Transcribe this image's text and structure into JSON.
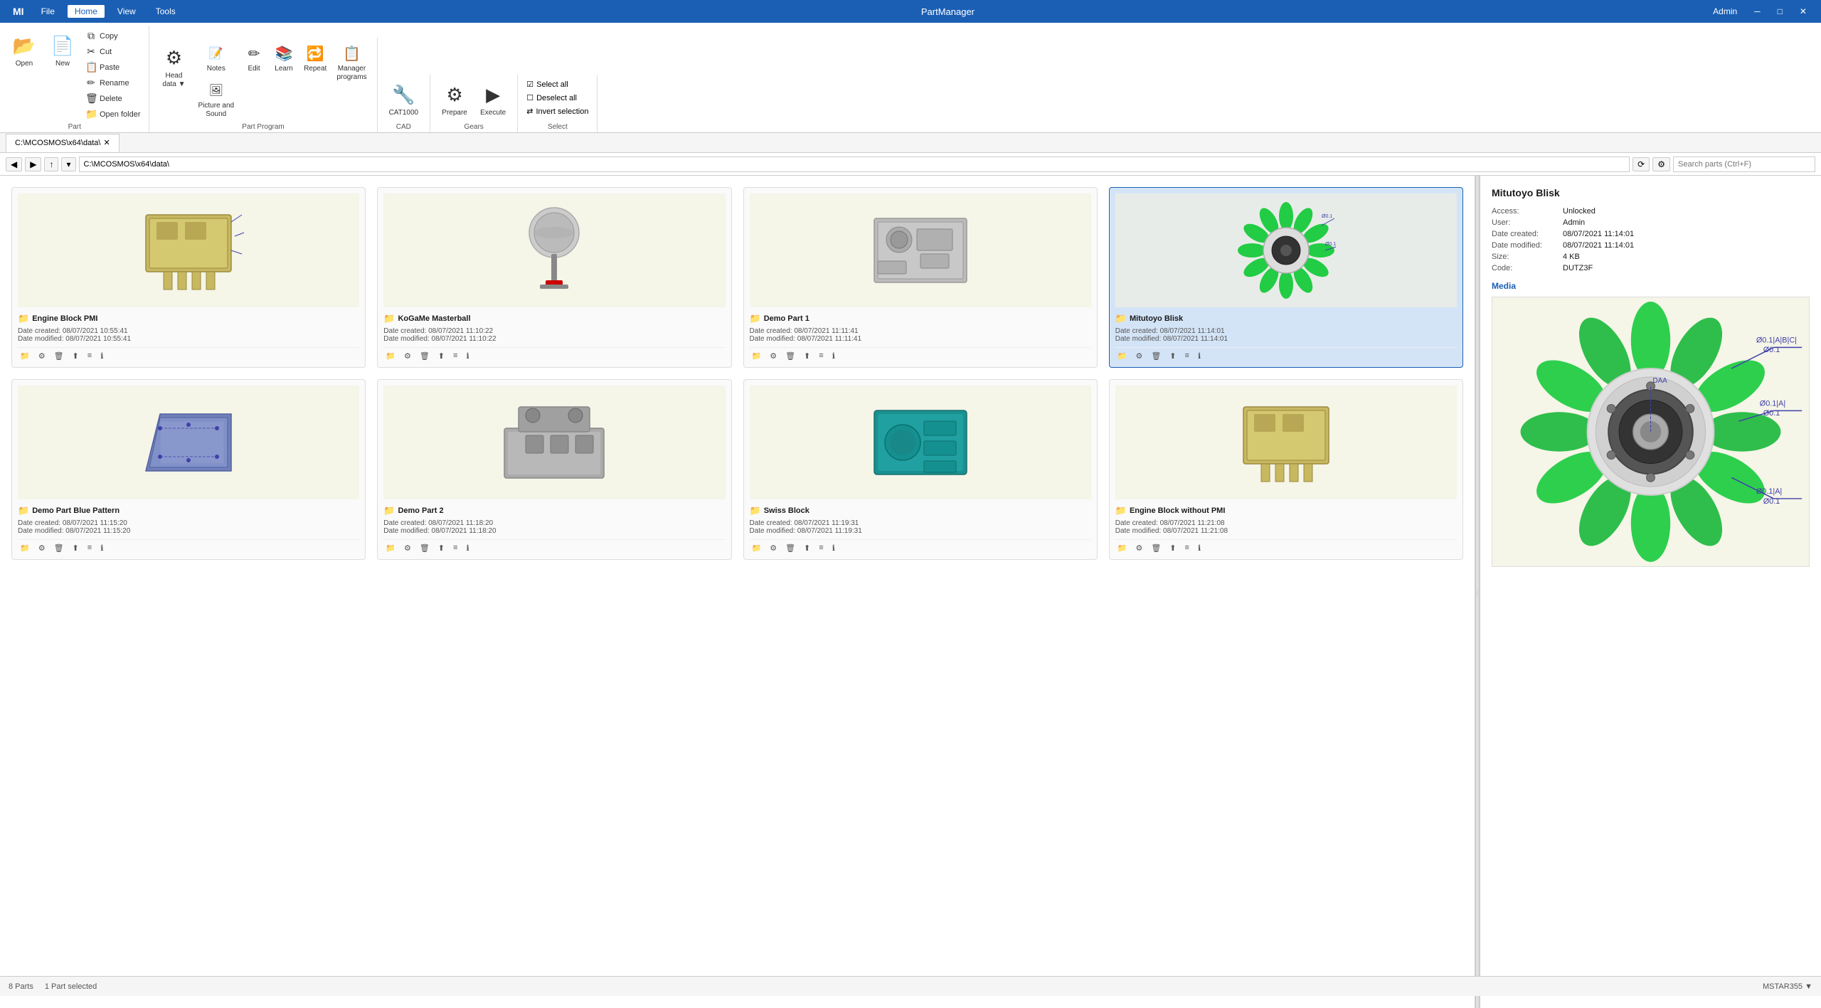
{
  "app": {
    "title": "PartManager",
    "logo": "MI",
    "user": "Admin",
    "minimize": "─",
    "maximize": "□",
    "close": "✕"
  },
  "menu": {
    "items": [
      "File",
      "Home",
      "View",
      "Tools"
    ],
    "active": "Home"
  },
  "ribbon": {
    "groups": [
      {
        "id": "file",
        "label": "",
        "buttons": [
          {
            "id": "open",
            "icon": "📂",
            "label": "Open",
            "large": true
          },
          {
            "id": "new",
            "icon": "📄",
            "label": "New",
            "large": true
          }
        ],
        "small_buttons": [
          {
            "id": "copy",
            "icon": "⧉",
            "label": "Copy"
          },
          {
            "id": "cut",
            "icon": "✂",
            "label": "Cut"
          },
          {
            "id": "paste",
            "icon": "📋",
            "label": "Paste"
          },
          {
            "id": "rename",
            "icon": "✏",
            "label": "Rename"
          },
          {
            "id": "delete",
            "icon": "🗑",
            "label": "Delete"
          },
          {
            "id": "open-folder",
            "icon": "📁",
            "label": "Open folder"
          }
        ]
      },
      {
        "id": "part-program",
        "label": "Part Program",
        "buttons": [
          {
            "id": "head",
            "icon": "⚙",
            "label": "Head\ndata ▼",
            "large": true
          },
          {
            "id": "notes",
            "icon": "📝",
            "label": "Notes",
            "large": false
          },
          {
            "id": "picture-sound",
            "icon": "🖼",
            "label": "Picture and\nSound",
            "large": false
          },
          {
            "id": "edit",
            "icon": "✏",
            "label": "Edit"
          },
          {
            "id": "learn",
            "icon": "📚",
            "label": "Learn"
          },
          {
            "id": "repeat",
            "icon": "🔁",
            "label": "Repeat"
          },
          {
            "id": "manager-programs",
            "icon": "📋",
            "label": "Manager\nprograms"
          }
        ]
      },
      {
        "id": "cad",
        "label": "CAD",
        "buttons": [
          {
            "id": "cat1000",
            "icon": "🔧",
            "label": "CAT1000",
            "large": true
          }
        ]
      },
      {
        "id": "gears",
        "label": "Gears",
        "buttons": [
          {
            "id": "prepare",
            "icon": "⚙",
            "label": "Prepare",
            "large": true
          },
          {
            "id": "execute",
            "icon": "▶",
            "label": "Execute",
            "large": true
          }
        ]
      },
      {
        "id": "select",
        "label": "Select",
        "select_buttons": [
          {
            "id": "select-all",
            "icon": "☑",
            "label": "Select all"
          },
          {
            "id": "deselect-all",
            "icon": "☐",
            "label": "Deselect all"
          },
          {
            "id": "invert-selection",
            "icon": "⇄",
            "label": "Invert selection"
          }
        ]
      }
    ]
  },
  "nav": {
    "back": "◀",
    "forward": "▶",
    "up": "↑",
    "address": "C:\\MCOSMOS\\x64\\data\\",
    "tab_label": "C:\\MCOSMOS\\x64\\data\\",
    "tab_close": "✕",
    "search_placeholder": "Search parts (Ctrl+F)",
    "refresh": "⟳",
    "options": "⚙"
  },
  "parts": [
    {
      "id": "engine-block-pmi",
      "name": "Engine Block PMI",
      "folder": true,
      "date_created": "08/07/2021 10:55:41",
      "date_modified": "08/07/2021 10:55:41",
      "selected": false,
      "thumb_color": "#f5f5e8",
      "thumb_type": "engine"
    },
    {
      "id": "kogame-masterball",
      "name": "KoGaMe Masterball",
      "folder": true,
      "date_created": "08/07/2021 11:10:22",
      "date_modified": "08/07/2021 11:10:22",
      "selected": false,
      "thumb_color": "#f5f5e8",
      "thumb_type": "masterball"
    },
    {
      "id": "demo-part-1",
      "name": "Demo Part 1",
      "folder": true,
      "date_created": "08/07/2021 11:11:41",
      "date_modified": "08/07/2021 11:11:41",
      "selected": false,
      "thumb_color": "#f5f5e8",
      "thumb_type": "block"
    },
    {
      "id": "mitutoyo-blisk",
      "name": "Mitutoyo Blisk",
      "folder": true,
      "date_created": "08/07/2021 11:14:01",
      "date_modified": "08/07/2021 11:14:01",
      "selected": true,
      "thumb_color": "#e8ece8",
      "thumb_type": "blisk"
    },
    {
      "id": "demo-part-blue-pattern",
      "name": "Demo Part Blue Pattern",
      "folder": true,
      "date_created": "08/07/2021 11:15:20",
      "date_modified": "08/07/2021 11:15:20",
      "selected": false,
      "thumb_color": "#f5f5e8",
      "thumb_type": "blue-part"
    },
    {
      "id": "demo-part-2",
      "name": "Demo Part 2",
      "folder": true,
      "date_created": "08/07/2021 11:18:20",
      "date_modified": "08/07/2021 11:18:20",
      "selected": false,
      "thumb_color": "#f5f5e8",
      "thumb_type": "demo2"
    },
    {
      "id": "swiss-block",
      "name": "Swiss Block",
      "folder": true,
      "date_created": "08/07/2021 11:19:31",
      "date_modified": "08/07/2021 11:19:31",
      "selected": false,
      "thumb_color": "#f5f5e8",
      "thumb_type": "swiss"
    },
    {
      "id": "engine-block-without-pmi",
      "name": "Engine Block without PMI",
      "folder": true,
      "date_created": "08/07/2021 11:21:08",
      "date_modified": "08/07/2021 11:21:08",
      "selected": false,
      "thumb_color": "#f5f5e8",
      "thumb_type": "engine2"
    }
  ],
  "details": {
    "title": "Mitutoyo Blisk",
    "fields": [
      {
        "label": "Access:",
        "value": "Unlocked"
      },
      {
        "label": "User:",
        "value": "Admin"
      },
      {
        "label": "Date created:",
        "value": "08/07/2021 11:14:01"
      },
      {
        "label": "Date modified:",
        "value": "08/07/2021 11:14:01"
      },
      {
        "label": "Size:",
        "value": "4 KB"
      },
      {
        "label": "Code:",
        "value": "DUTZ3F"
      }
    ],
    "media_label": "Media"
  },
  "status_bar": {
    "parts_count": "8 Parts",
    "selected_count": "1 Part selected",
    "version": "MSTAR355 ▼"
  },
  "colors": {
    "accent": "#1a5fb4",
    "ribbon_bg": "#ffffff",
    "card_selected": "#d4e4f7",
    "thumb_bg": "#f5f5e8"
  },
  "labels": {
    "date_created": "Date created:",
    "date_modified": "Date modified:"
  }
}
